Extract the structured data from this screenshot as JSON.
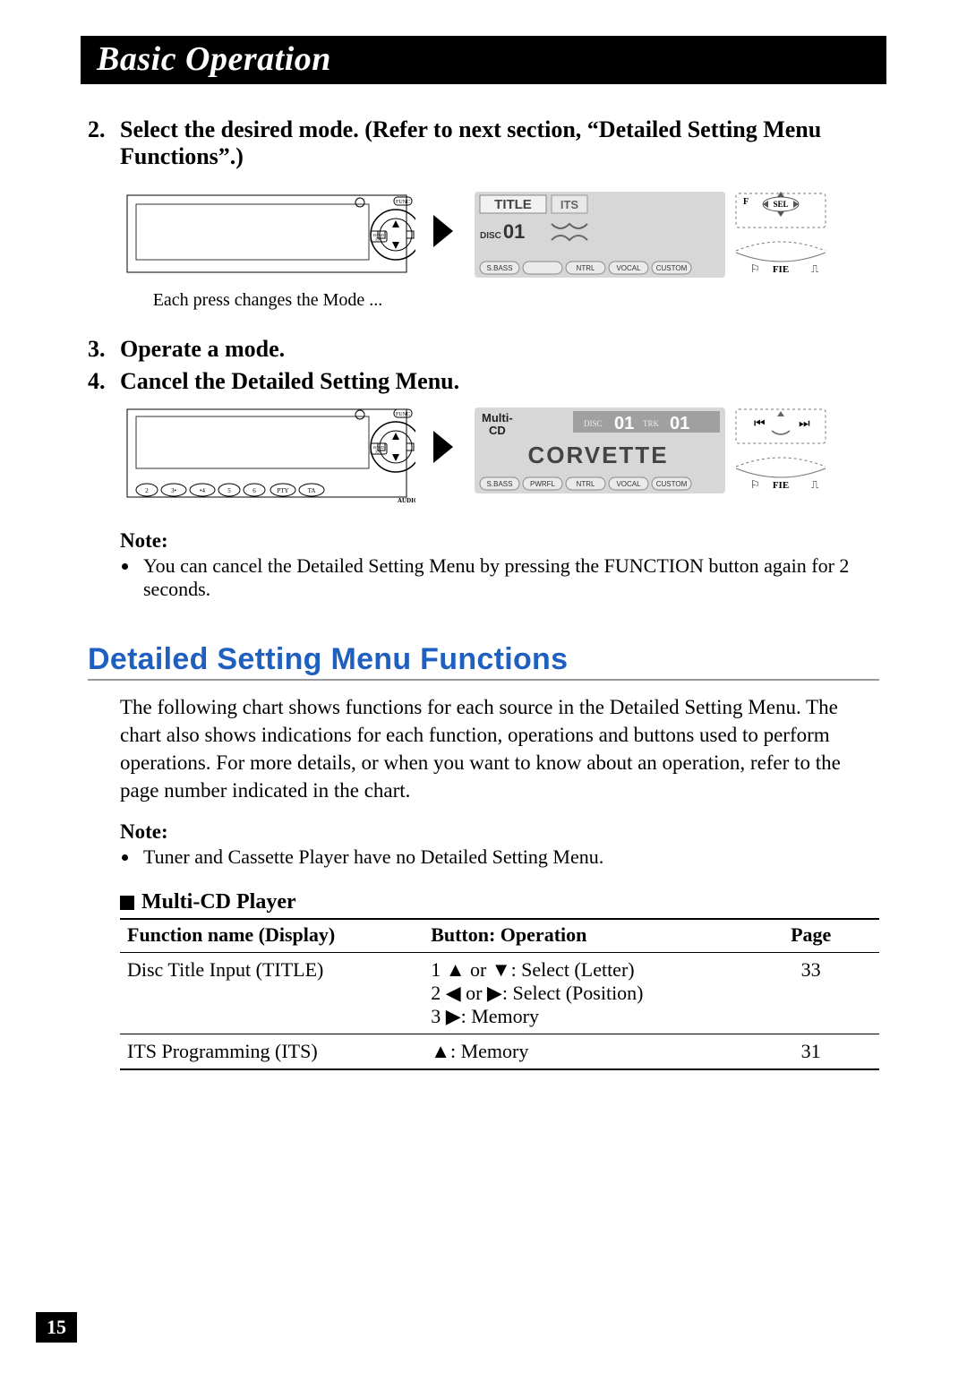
{
  "header": {
    "title": "Basic Operation"
  },
  "steps": {
    "s2": {
      "num": "2.",
      "text": "Select the desired mode. (Refer to next section, “Detailed Setting Menu Functions”.)"
    },
    "caption2": "Each press changes the Mode ...",
    "s3": {
      "num": "3.",
      "text": "Operate a mode."
    },
    "s4": {
      "num": "4.",
      "text": "Cancel the Detailed Setting Menu."
    }
  },
  "note1": {
    "title": "Note:",
    "items": [
      "You can cancel the Detailed Setting Menu by pressing the FUNCTION button again for 2 seconds."
    ]
  },
  "section2": {
    "title": "Detailed Setting Menu Functions",
    "text": "The following chart shows functions for each source in the Detailed Setting Menu. The chart also shows indications for each function, operations and buttons used to perform operations. For more details, or when you want to know about an operation, refer to the page number indicated in the chart."
  },
  "note2": {
    "title": "Note:",
    "items": [
      "Tuner and Cassette Player have no Detailed Setting Menu."
    ]
  },
  "table": {
    "subhead": "Multi-CD Player",
    "headers": {
      "c1": "Function name (Display)",
      "c2": "Button: Operation",
      "c3": "Page"
    },
    "rows": [
      {
        "c1": "Disc Title Input (TITLE)",
        "c2": "1 ▲ or ▼: Select (Letter)\n2 ◀ or ▶: Select (Position)\n3 ▶: Memory",
        "c3": "33"
      },
      {
        "c1": "ITS Programming (ITS)",
        "c2": "▲: Memory",
        "c3": "31"
      }
    ]
  },
  "lcd1": {
    "title": "TITLE",
    "its": "ITS",
    "disc": "DISC 01",
    "btns": [
      "S.BASS",
      "",
      "NTRL",
      "VOCAL",
      "CUSTOM"
    ],
    "right": {
      "f": "F",
      "sel": "SEL",
      "fie": "FIE"
    }
  },
  "lcd2": {
    "multi": "Multi-\nCD",
    "disc": "DISC 01",
    "trk": "TRK 01",
    "name": "CORVETTE",
    "btns": [
      "S.BASS",
      "PWRFL",
      "NTRL",
      "VOCAL",
      "CUSTOM"
    ],
    "right": {
      "prev": "⏮",
      "next": "⏭",
      "fie": "FIE"
    }
  },
  "radio": {
    "func": "FUNC",
    "band": "BAND\nESC",
    "audio": "AUDIO"
  },
  "pageNumber": "15"
}
